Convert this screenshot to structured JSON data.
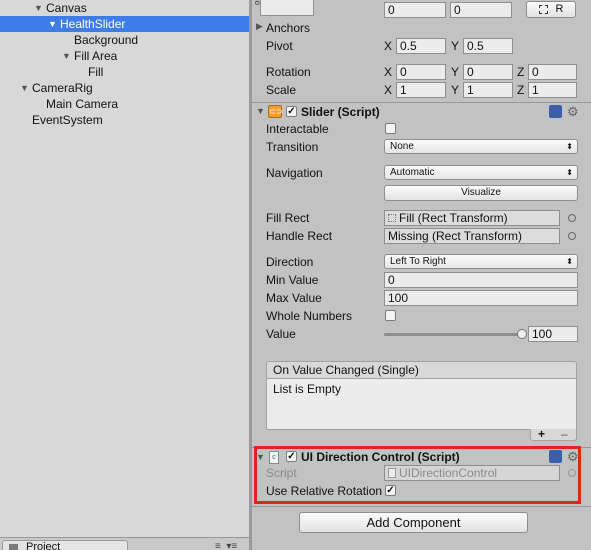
{
  "hierarchy": {
    "items": [
      {
        "label": "Canvas",
        "expanded": true
      },
      {
        "label": "HealthSlider",
        "expanded": true,
        "selected": true
      },
      {
        "label": "Background"
      },
      {
        "label": "Fill Area",
        "expanded": true
      },
      {
        "label": "Fill"
      },
      {
        "label": "CameraRig",
        "expanded": true
      },
      {
        "label": "Main Camera"
      },
      {
        "label": "EventSystem"
      }
    ],
    "project_tab": "Project"
  },
  "rect_transform": {
    "top_values": [
      "0",
      "0"
    ],
    "r_button": "R",
    "anchors_label": "Anchors",
    "pivot": {
      "label": "Pivot",
      "x": "0.5",
      "y": "0.5"
    },
    "rotation": {
      "label": "Rotation",
      "x": "0",
      "y": "0",
      "z": "0"
    },
    "scale": {
      "label": "Scale",
      "x": "1",
      "y": "1",
      "z": "1"
    },
    "axis_x": "X",
    "axis_y": "Y",
    "axis_z": "Z"
  },
  "slider": {
    "title": "Slider (Script)",
    "interactable_label": "Interactable",
    "interactable": false,
    "transition_label": "Transition",
    "transition_value": "None",
    "navigation_label": "Navigation",
    "navigation_value": "Automatic",
    "visualize_label": "Visualize",
    "fill_rect_label": "Fill Rect",
    "fill_rect_value": "Fill (Rect Transform)",
    "handle_rect_label": "Handle Rect",
    "handle_rect_value": "Missing (Rect Transform)",
    "direction_label": "Direction",
    "direction_value": "Left To Right",
    "min_label": "Min Value",
    "min_value": "0",
    "max_label": "Max Value",
    "max_value": "100",
    "whole_numbers_label": "Whole Numbers",
    "whole_numbers": false,
    "value_label": "Value",
    "value": "100",
    "value_fraction": 1.0,
    "event_title": "On Value Changed (Single)",
    "event_empty": "List is Empty"
  },
  "ui_direction": {
    "title": "UI Direction Control (Script)",
    "script_label": "Script",
    "script_value": "UIDirectionControl",
    "use_relative_label": "Use Relative Rotation",
    "use_relative": true
  },
  "add_component_label": "Add Component",
  "colors": {
    "selection": "#3e7de7",
    "highlight": "#e1251b",
    "panel": "#c2c2c2"
  }
}
